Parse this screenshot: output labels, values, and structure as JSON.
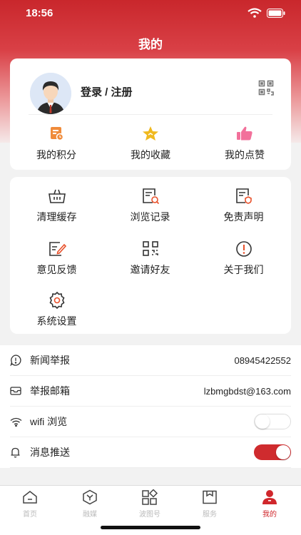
{
  "status": {
    "time": "18:56"
  },
  "header": {
    "title": "我的"
  },
  "profile": {
    "login_label": "登录 / 注册",
    "quick": [
      {
        "label": "我的积分",
        "icon": "points-icon"
      },
      {
        "label": "我的收藏",
        "icon": "star-icon"
      },
      {
        "label": "我的点赞",
        "icon": "thumbs-up-icon"
      }
    ]
  },
  "tools": [
    {
      "label": "清理缓存",
      "icon": "basket-icon"
    },
    {
      "label": "浏览记录",
      "icon": "history-icon"
    },
    {
      "label": "免责声明",
      "icon": "disclaimer-icon"
    },
    {
      "label": "意见反馈",
      "icon": "feedback-icon"
    },
    {
      "label": "邀请好友",
      "icon": "qr-invite-icon"
    },
    {
      "label": "关于我们",
      "icon": "info-icon"
    },
    {
      "label": "系统设置",
      "icon": "gear-icon"
    }
  ],
  "settings": {
    "news_report": {
      "label": "新闻举报",
      "value": "08945422552"
    },
    "report_email": {
      "label": "举报邮箱",
      "value": "lzbmgbdst@163.com"
    },
    "wifi_browse": {
      "label": "wifi 浏览",
      "enabled": false
    },
    "push": {
      "label": "消息推送",
      "enabled": true
    }
  },
  "tabs": [
    {
      "label": "首页",
      "icon": "home-icon",
      "active": false
    },
    {
      "label": "融媒",
      "icon": "media-icon",
      "active": false
    },
    {
      "label": "波图号",
      "icon": "apps-icon",
      "active": false
    },
    {
      "label": "服务",
      "icon": "bookmark-icon",
      "active": false
    },
    {
      "label": "我的",
      "icon": "user-icon",
      "active": true
    }
  ],
  "colors": {
    "brand_red": "#cf2b2e",
    "star_yellow": "#f0b91e",
    "pink": "#f2719b"
  }
}
